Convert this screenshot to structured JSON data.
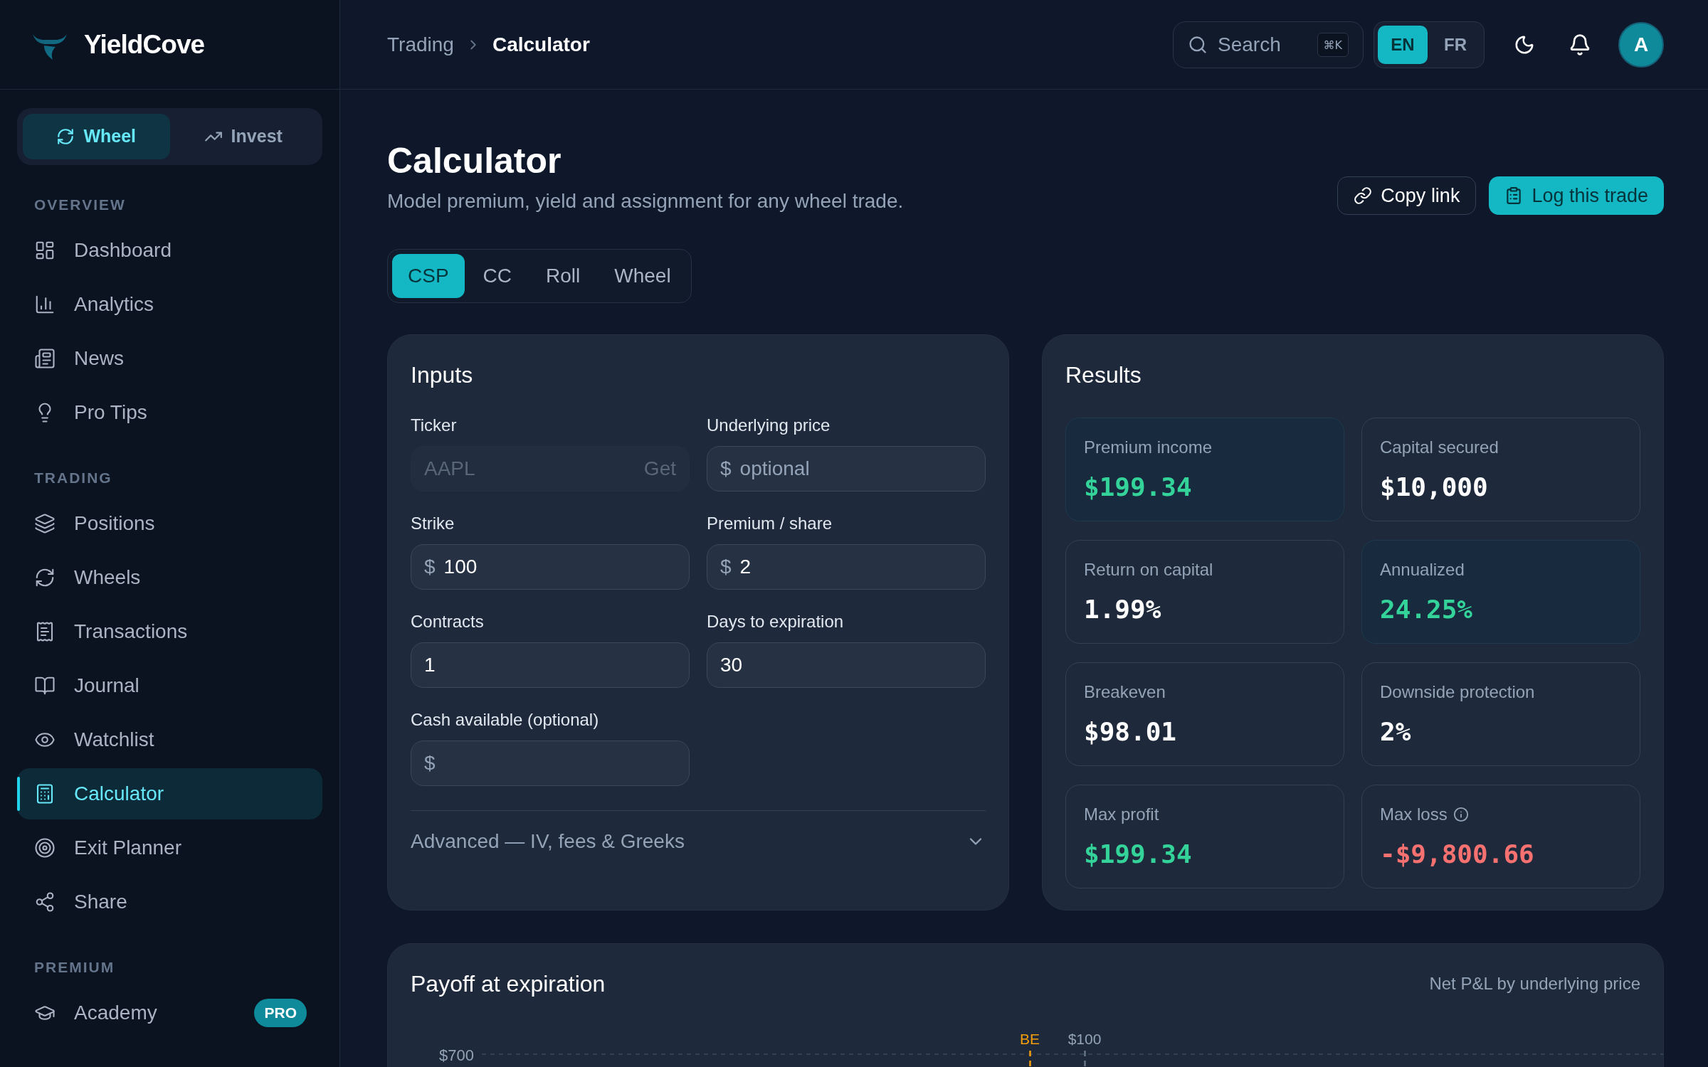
{
  "sidebar": {
    "brand": "YieldCove",
    "modes": [
      {
        "label": "Wheel",
        "selected": true
      },
      {
        "label": "Invest",
        "selected": false
      }
    ],
    "sections": [
      {
        "title": "OVERVIEW",
        "items": [
          {
            "label": "Dashboard",
            "selected": false
          },
          {
            "label": "Analytics",
            "selected": false
          },
          {
            "label": "News",
            "selected": false
          },
          {
            "label": "Pro Tips",
            "selected": false
          }
        ]
      },
      {
        "title": "TRADING",
        "items": [
          {
            "label": "Positions",
            "selected": false
          },
          {
            "label": "Wheels",
            "selected": false
          },
          {
            "label": "Transactions",
            "selected": false
          },
          {
            "label": "Journal",
            "selected": false
          },
          {
            "label": "Watchlist",
            "selected": false
          },
          {
            "label": "Calculator",
            "selected": true
          },
          {
            "label": "Exit Planner",
            "selected": false
          },
          {
            "label": "Share",
            "selected": false
          }
        ]
      },
      {
        "title": "PREMIUM",
        "items": [
          {
            "label": "Academy",
            "selected": false,
            "badge": "PRO"
          }
        ]
      }
    ]
  },
  "header": {
    "breadcrumb": [
      "Trading",
      "Calculator"
    ],
    "search": {
      "placeholder": "Search",
      "shortcut": "⌘K"
    },
    "languages": [
      {
        "label": "EN",
        "selected": true
      },
      {
        "label": "FR",
        "selected": false
      }
    ],
    "avatar": "A"
  },
  "page": {
    "title": "Calculator",
    "subtitle": "Model premium, yield and assignment for any wheel trade.",
    "actions": [
      {
        "label": "Copy link",
        "kind": "secondary"
      },
      {
        "label": "Log this trade",
        "kind": "primary"
      }
    ],
    "tabs": [
      {
        "label": "CSP",
        "selected": true
      },
      {
        "label": "CC",
        "selected": false
      },
      {
        "label": "Roll",
        "selected": false
      },
      {
        "label": "Wheel",
        "selected": false
      }
    ]
  },
  "inputs": {
    "title": "Inputs",
    "fields": [
      {
        "label": "Ticker",
        "placeholder": "AAPL",
        "action": "Get",
        "disabled": true
      },
      {
        "label": "Underlying price",
        "prefix": "$",
        "placeholder": "optional",
        "disabled": false
      },
      {
        "label": "Strike",
        "prefix": "$",
        "value": "100",
        "disabled": false
      },
      {
        "label": "Premium / share",
        "prefix": "$",
        "value": "2",
        "disabled": false
      },
      {
        "label": "Contracts",
        "value": "1",
        "disabled": false
      },
      {
        "label": "Days to expiration",
        "value": "30",
        "disabled": false
      },
      {
        "label": "Cash available (optional)",
        "prefix": "$",
        "disabled": false
      }
    ],
    "advanced": {
      "label": "Advanced — IV, fees & Greeks",
      "expanded": false
    }
  },
  "results": {
    "title": "Results",
    "metrics": [
      {
        "label": "Premium income",
        "value": "$199.34",
        "kind": "gain",
        "highlighted": true,
        "info": false
      },
      {
        "label": "Capital secured",
        "value": "$10,000",
        "kind": "plain",
        "highlighted": false,
        "info": false
      },
      {
        "label": "Return on capital",
        "value": "1.99%",
        "kind": "plain",
        "highlighted": false,
        "info": false
      },
      {
        "label": "Annualized",
        "value": "24.25%",
        "kind": "gain",
        "highlighted": true,
        "info": false
      },
      {
        "label": "Breakeven",
        "value": "$98.01",
        "kind": "plain",
        "highlighted": false,
        "info": false
      },
      {
        "label": "Downside protection",
        "value": "2%",
        "kind": "plain",
        "highlighted": false,
        "info": false
      },
      {
        "label": "Max profit",
        "value": "$199.34",
        "kind": "gain",
        "highlighted": false,
        "info": false
      },
      {
        "label": "Max loss",
        "value": "-$9,800.66",
        "kind": "loss",
        "highlighted": false,
        "info": true
      }
    ]
  },
  "payoff": {
    "title": "Payoff at expiration",
    "caption": "Net P&L by underlying price",
    "y_tick": "$700",
    "markers": [
      {
        "label": "BE",
        "kind": "breakeven"
      },
      {
        "label": "$100",
        "kind": "strike"
      }
    ]
  }
}
